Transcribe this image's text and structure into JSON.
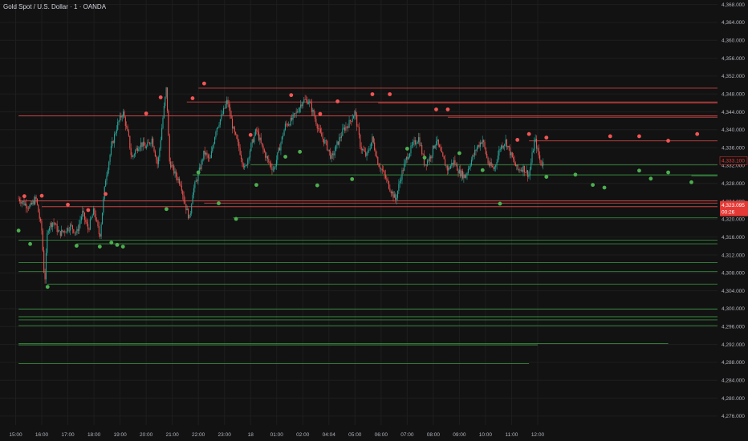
{
  "header": {
    "title": "Gold Spot / U.S. Dollar · 1 · OANDA"
  },
  "colors": {
    "background": "#121212",
    "grid": "#1e1e1e",
    "up_candle": "#26a69a",
    "down_candle": "#ef5350",
    "swing_high": "#f25555",
    "swing_low": "#4caf50",
    "resistance_line": "#e74c4c",
    "support_line": "#3d9e46",
    "price_badge": "#e53935",
    "current_price_badge": "#26a69a"
  },
  "chart_data": {
    "type": "candlestick",
    "title": "Gold Spot / U.S. Dollar · 1 · OANDA",
    "y_axis": {
      "ylim": [
        4274.0,
        4369.0
      ],
      "tick_labels": [
        "4,368.000",
        "4,364.000",
        "4,360.000",
        "4,356.000",
        "4,352.000",
        "4,348.000",
        "4,344.000",
        "4,340.000",
        "4,336.000",
        "4,332.000",
        "4,328.000",
        "4,324.000",
        "4,320.000",
        "4,316.000",
        "4,312.000",
        "4,308.000",
        "4,304.000",
        "4,300.000",
        "4,296.000",
        "4,292.000",
        "4,288.000",
        "4,284.000",
        "4,280.000",
        "4,276.000"
      ],
      "tick_values": [
        4368,
        4364,
        4360,
        4356,
        4352,
        4348,
        4344,
        4340,
        4336,
        4332,
        4328,
        4324,
        4320,
        4316,
        4312,
        4308,
        4304,
        4300,
        4296,
        4292,
        4288,
        4284,
        4280,
        4276
      ]
    },
    "x_axis": {
      "tick_labels": [
        "15:00",
        "16:00",
        "17:00",
        "18:00",
        "19:00",
        "20:00",
        "21:00",
        "22:00",
        "23:00",
        "18",
        "01:00",
        "02:00",
        "04:04",
        "05:00",
        "06:00",
        "07:00",
        "08:00",
        "09:00",
        "10:00",
        "11:00",
        "12:00"
      ],
      "tick_positions": [
        -0.5,
        4,
        8.5,
        13,
        17.5,
        22,
        26.5,
        31,
        35.5,
        40,
        44.5,
        49,
        53.5,
        58,
        62.5,
        67,
        71.5,
        76,
        80.5,
        85,
        89.5
      ]
    },
    "price_path": [
      [
        0,
        4324.6
      ],
      [
        1,
        4323.5
      ],
      [
        2,
        4322.7
      ],
      [
        3,
        4324.7
      ],
      [
        4,
        4317.4
      ],
      [
        4.5,
        4305.4
      ],
      [
        5,
        4318
      ],
      [
        6,
        4319.5
      ],
      [
        7,
        4316.8
      ],
      [
        8,
        4317.5
      ],
      [
        9,
        4318.5
      ],
      [
        10,
        4316.8
      ],
      [
        11,
        4321.5
      ],
      [
        12,
        4317.7
      ],
      [
        13,
        4322
      ],
      [
        14,
        4316
      ],
      [
        15,
        4329
      ],
      [
        16,
        4336
      ],
      [
        17,
        4341
      ],
      [
        18,
        4344
      ],
      [
        19,
        4338
      ],
      [
        19.5,
        4333.5
      ],
      [
        20,
        4335
      ],
      [
        21,
        4337
      ],
      [
        22,
        4336
      ],
      [
        23,
        4338
      ],
      [
        24,
        4332
      ],
      [
        25,
        4344
      ],
      [
        25.5,
        4349.5
      ],
      [
        26,
        4333
      ],
      [
        27,
        4330
      ],
      [
        28,
        4328
      ],
      [
        28.5,
        4324.5
      ],
      [
        29,
        4322
      ],
      [
        29.5,
        4320
      ],
      [
        30,
        4326
      ],
      [
        31,
        4330
      ],
      [
        32,
        4335
      ],
      [
        33,
        4333
      ],
      [
        34,
        4340
      ],
      [
        35,
        4343
      ],
      [
        36,
        4346.5
      ],
      [
        37,
        4340
      ],
      [
        38,
        4336
      ],
      [
        39,
        4331
      ],
      [
        40,
        4336
      ],
      [
        41,
        4340
      ],
      [
        42,
        4336
      ],
      [
        43,
        4333
      ],
      [
        44,
        4331
      ],
      [
        45,
        4336
      ],
      [
        46,
        4341
      ],
      [
        47,
        4342
      ],
      [
        48,
        4344
      ],
      [
        49,
        4346.5
      ],
      [
        50,
        4346.5
      ],
      [
        51,
        4343
      ],
      [
        52,
        4339
      ],
      [
        53,
        4336.8
      ],
      [
        54,
        4333.5
      ],
      [
        55,
        4337
      ],
      [
        56,
        4340
      ],
      [
        57,
        4341.5
      ],
      [
        58,
        4344
      ],
      [
        59,
        4336
      ],
      [
        60,
        4334
      ],
      [
        61,
        4338
      ],
      [
        62,
        4332.5
      ],
      [
        63,
        4330
      ],
      [
        64,
        4327
      ],
      [
        65,
        4324.3
      ],
      [
        66,
        4330
      ],
      [
        67,
        4334
      ],
      [
        68,
        4336.6
      ],
      [
        69,
        4338.2
      ],
      [
        70,
        4332.2
      ],
      [
        71,
        4334
      ],
      [
        72,
        4337.8
      ],
      [
        73,
        4334
      ],
      [
        74,
        4331
      ],
      [
        75,
        4333
      ],
      [
        76,
        4330.5
      ],
      [
        77,
        4329.5
      ],
      [
        78,
        4333
      ],
      [
        79,
        4336
      ],
      [
        80,
        4337.8
      ],
      [
        81,
        4332.3
      ],
      [
        82,
        4331.2
      ],
      [
        83,
        4336
      ],
      [
        84,
        4337.5
      ],
      [
        85,
        4334
      ],
      [
        86,
        4331
      ],
      [
        87,
        4331.5
      ],
      [
        88,
        4329.8
      ],
      [
        89,
        4338
      ],
      [
        90,
        4332.5
      ]
    ],
    "swing_highs": [
      {
        "x": 1,
        "price": 4324.6
      },
      {
        "x": 4,
        "price": 4324.7
      },
      {
        "x": 8.5,
        "price": 4322.7
      },
      {
        "x": 12,
        "price": 4321.5
      },
      {
        "x": 15,
        "price": 4325.1
      },
      {
        "x": 22,
        "price": 4343.1
      },
      {
        "x": 24.5,
        "price": 4346.7
      },
      {
        "x": 30,
        "price": 4346.5
      },
      {
        "x": 32,
        "price": 4349.8
      },
      {
        "x": 40,
        "price": 4338.3
      },
      {
        "x": 47,
        "price": 4347.2
      },
      {
        "x": 52,
        "price": 4343
      },
      {
        "x": 55,
        "price": 4345.8
      },
      {
        "x": 61,
        "price": 4347.4
      },
      {
        "x": 64,
        "price": 4347.4
      },
      {
        "x": 72,
        "price": 4344
      },
      {
        "x": 74,
        "price": 4344
      },
      {
        "x": 86,
        "price": 4337.2
      },
      {
        "x": 88,
        "price": 4338.5
      },
      {
        "x": 91,
        "price": 4337.7
      },
      {
        "x": 102,
        "price": 4338
      },
      {
        "x": 107,
        "price": 4338
      },
      {
        "x": 112,
        "price": 4337
      },
      {
        "x": 117,
        "price": 4338.5
      }
    ],
    "swing_lows": [
      {
        "x": 0,
        "price": 4318
      },
      {
        "x": 2,
        "price": 4315
      },
      {
        "x": 5,
        "price": 4305.4
      },
      {
        "x": 10,
        "price": 4314.6
      },
      {
        "x": 14,
        "price": 4314.4
      },
      {
        "x": 16,
        "price": 4315.3
      },
      {
        "x": 17,
        "price": 4314.8
      },
      {
        "x": 18,
        "price": 4314.4
      },
      {
        "x": 25.5,
        "price": 4322.8
      },
      {
        "x": 31,
        "price": 4331
      },
      {
        "x": 34.5,
        "price": 4324.1
      },
      {
        "x": 37.5,
        "price": 4320.6
      },
      {
        "x": 41,
        "price": 4328.2
      },
      {
        "x": 46,
        "price": 4334.5
      },
      {
        "x": 48.5,
        "price": 4335.6
      },
      {
        "x": 51.5,
        "price": 4328.1
      },
      {
        "x": 57.5,
        "price": 4329.5
      },
      {
        "x": 67,
        "price": 4336.3
      },
      {
        "x": 70,
        "price": 4334.3
      },
      {
        "x": 76,
        "price": 4335.3
      },
      {
        "x": 80,
        "price": 4331.5
      },
      {
        "x": 83,
        "price": 4324
      },
      {
        "x": 91,
        "price": 4330
      },
      {
        "x": 96,
        "price": 4330.5
      },
      {
        "x": 99,
        "price": 4328.2
      },
      {
        "x": 101,
        "price": 4327.6
      },
      {
        "x": 107,
        "price": 4331.4
      },
      {
        "x": 109,
        "price": 4329.6
      },
      {
        "x": 112,
        "price": 4331
      },
      {
        "x": 116,
        "price": 4328.8
      }
    ],
    "resistance_levels": [
      {
        "price": 4349.3,
        "x_start": 31
      },
      {
        "price": 4346.2,
        "x_start": 29
      },
      {
        "price": 4346,
        "x_start": 62
      },
      {
        "price": 4343.1,
        "x_start": 0
      },
      {
        "price": 4342.8,
        "x_start": 74
      },
      {
        "price": 4337.5,
        "x_start": 88
      },
      {
        "price": 4324.1,
        "x_start": 0
      },
      {
        "price": 4322.8,
        "x_start": 4
      },
      {
        "price": 4323.6,
        "x_start": 32
      }
    ],
    "support_levels": [
      {
        "price": 4332.2,
        "x_start": 40
      },
      {
        "price": 4329.9,
        "x_start": 30
      },
      {
        "price": 4329.7,
        "x_start": 116
      },
      {
        "price": 4320.3,
        "x_start": 37
      },
      {
        "price": 4315.3,
        "x_start": 0
      },
      {
        "price": 4314.5,
        "x_start": 10
      },
      {
        "price": 4310.3,
        "x_start": 0
      },
      {
        "price": 4308.3,
        "x_start": 0
      },
      {
        "price": 4305.5,
        "x_start": 5
      },
      {
        "price": 4299.9,
        "x_start": 0
      },
      {
        "price": 4298.2,
        "x_start": 0
      },
      {
        "price": 4297.5,
        "x_start": 0
      },
      {
        "price": 4296.2,
        "x_start": 0
      },
      {
        "price": 4292.2,
        "x_start": 0,
        "x_end": 112
      },
      {
        "price": 4291.9,
        "x_start": 0,
        "x_end": 89.5
      },
      {
        "price": 4287.7,
        "x_start": 0,
        "x_end": 88
      }
    ],
    "current_price": {
      "price": 4333.1,
      "label": "4,333.100"
    },
    "badge": {
      "price": 4323.095,
      "price_label": "4,323.095",
      "time_label": "00:26"
    }
  }
}
